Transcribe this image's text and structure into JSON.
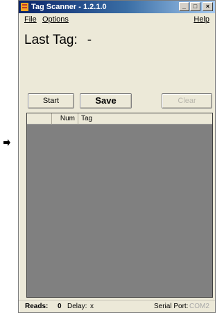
{
  "window": {
    "title": "Tag Scanner - 1.2.1.0",
    "controls": {
      "minimize": "_",
      "maximize": "□",
      "close": "×"
    }
  },
  "menu": {
    "file": "File",
    "options": "Options",
    "help": "Help"
  },
  "last_tag": {
    "label": "Last Tag:",
    "value": "-"
  },
  "buttons": {
    "start": "Start",
    "save": "Save",
    "clear": "Clear"
  },
  "list": {
    "columns": [
      "",
      "Num",
      "Tag"
    ]
  },
  "status": {
    "reads_label": "Reads:",
    "reads_value": "0",
    "delay_label": "Delay:",
    "delay_value": "x",
    "port_label": "Serial Port:",
    "port_value": "COM2"
  },
  "icons": {
    "app": "app-icon",
    "pointer": "arrow-pointer-icon"
  }
}
